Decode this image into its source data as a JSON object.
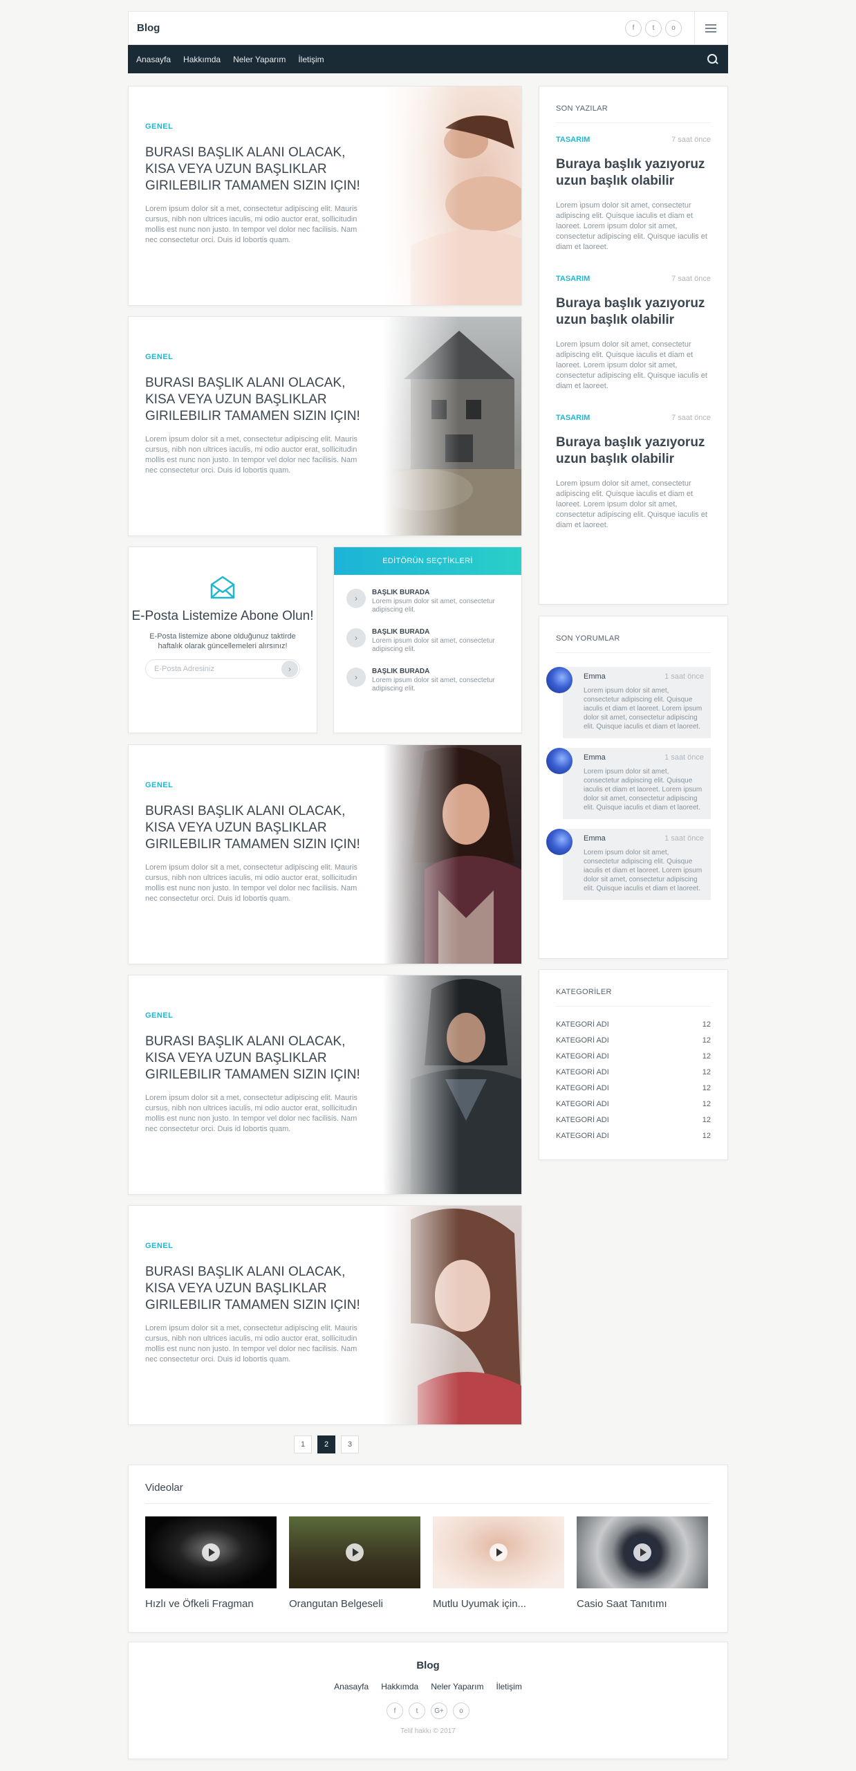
{
  "header": {
    "brand": "Blog",
    "social": [
      "f",
      "t",
      "o"
    ],
    "menu_icon": "hamburger-icon"
  },
  "nav": {
    "links": [
      "Anasayfa",
      "Hakkımda",
      "Neler Yaparım",
      "İletişim"
    ],
    "search_icon": "search-icon"
  },
  "posts": [
    {
      "category": "GENEL",
      "title": "BURASI BAŞLIK ALANI OLACAK, KISA VEYA UZUN BAŞLIKLAR GIRILEBILIR TAMAMEN SIZIN IÇIN!",
      "excerpt": "Lorem ipsum dolor sit a met, consectetur adipiscing elit. Mauris cursus, nibh non ultrices iaculis, mi odio auctor erat, sollicitudin mollis est nunc non justo. In tempor vel dolor nec facilisis. Nam nec consectetur orci. Duis id lobortis quam."
    },
    {
      "category": "GENEL",
      "title": "BURASI BAŞLIK ALANI OLACAK, KISA VEYA UZUN BAŞLIKLAR GIRILEBILIR TAMAMEN SIZIN IÇIN!",
      "excerpt": "Lorem ipsum dolor sit a met, consectetur adipiscing elit. Mauris cursus, nibh non ultrices iaculis, mi odio auctor erat, sollicitudin mollis est nunc non justo. In tempor vel dolor nec facilisis. Nam nec consectetur orci. Duis id lobortis quam."
    },
    {
      "category": "GENEL",
      "title": "BURASI BAŞLIK ALANI OLACAK, KISA VEYA UZUN BAŞLIKLAR GIRILEBILIR TAMAMEN SIZIN IÇIN!",
      "excerpt": "Lorem ipsum dolor sit a met, consectetur adipiscing elit. Mauris cursus, nibh non ultrices iaculis, mi odio auctor erat, sollicitudin mollis est nunc non justo. In tempor vel dolor nec facilisis. Nam nec consectetur orci. Duis id lobortis quam."
    },
    {
      "category": "GENEL",
      "title": "BURASI BAŞLIK ALANI OLACAK, KISA VEYA UZUN BAŞLIKLAR GIRILEBILIR TAMAMEN SIZIN IÇIN!",
      "excerpt": "Lorem ipsum dolor sit a met, consectetur adipiscing elit. Mauris cursus, nibh non ultrices iaculis, mi odio auctor erat, sollicitudin mollis est nunc non justo. In tempor vel dolor nec facilisis. Nam nec consectetur orci. Duis id lobortis quam."
    },
    {
      "category": "GENEL",
      "title": "BURASI BAŞLIK ALANI OLACAK, KISA VEYA UZUN BAŞLIKLAR GIRILEBILIR TAMAMEN SIZIN IÇIN!",
      "excerpt": "Lorem ipsum dolor sit a met, consectetur adipiscing elit. Mauris cursus, nibh non ultrices iaculis, mi odio auctor erat, sollicitudin mollis est nunc non justo. In tempor vel dolor nec facilisis. Nam nec consectetur orci. Duis id lobortis quam."
    }
  ],
  "subscribe": {
    "title": "E-Posta Listemize Abone Olun!",
    "text": "E-Posta listemize abone olduğunuz taktirde haftalık olarak güncellemeleri alırsınız!",
    "placeholder": "E-Posta Adresiniz",
    "icon": "envelope-icon"
  },
  "editor_picks": {
    "title": "EDİTÖRÜN SEÇTİKLERİ",
    "items": [
      {
        "title": "BAŞLIK BURADA",
        "text": "Lorem ipsum dolor sit amet, consectetur adipiscing elit."
      },
      {
        "title": "BAŞLIK BURADA",
        "text": "Lorem ipsum dolor sit amet, consectetur adipiscing elit."
      },
      {
        "title": "BAŞLIK BURADA",
        "text": "Lorem ipsum dolor sit amet, consectetur adipiscing elit."
      }
    ]
  },
  "pagination": [
    "1",
    "2",
    "3"
  ],
  "pagination_active": "2",
  "recent": {
    "title": "SON YAZILAR",
    "items": [
      {
        "category": "TASARIM",
        "time": "7 saat önce",
        "title": "Buraya başlık yazıyoruz uzun başlık olabilir",
        "excerpt": "Lorem ipsum dolor sit amet, consectetur adipiscing elit. Quisque iaculis et diam et laoreet. Lorem ipsum dolor sit amet, consectetur adipiscing elit. Quisque iaculis et diam et laoreet."
      },
      {
        "category": "TASARIM",
        "time": "7 saat önce",
        "title": "Buraya başlık yazıyoruz uzun başlık olabilir",
        "excerpt": "Lorem ipsum dolor sit amet, consectetur adipiscing elit. Quisque iaculis et diam et laoreet. Lorem ipsum dolor sit amet, consectetur adipiscing elit. Quisque iaculis et diam et laoreet."
      },
      {
        "category": "TASARIM",
        "time": "7 saat önce",
        "title": "Buraya başlık yazıyoruz uzun başlık olabilir",
        "excerpt": "Lorem ipsum dolor sit amet, consectetur adipiscing elit. Quisque iaculis et diam et laoreet. Lorem ipsum dolor sit amet, consectetur adipiscing elit. Quisque iaculis et diam et laoreet."
      }
    ]
  },
  "comments": {
    "title": "SON YORUMLAR",
    "items": [
      {
        "name": "Emma",
        "time": "1 saat önce",
        "text": "Lorem ipsum dolor sit amet, consectetur adipiscing elit. Quisque iaculis et diam et laoreet. Lorem ipsum dolor sit amet, consectetur adipiscing elit. Quisque iaculis et diam et laoreet."
      },
      {
        "name": "Emma",
        "time": "1 saat önce",
        "text": "Lorem ipsum dolor sit amet, consectetur adipiscing elit. Quisque iaculis et diam et laoreet. Lorem ipsum dolor sit amet, consectetur adipiscing elit. Quisque iaculis et diam et laoreet."
      },
      {
        "name": "Emma",
        "time": "1 saat önce",
        "text": "Lorem ipsum dolor sit amet, consectetur adipiscing elit. Quisque iaculis et diam et laoreet. Lorem ipsum dolor sit amet, consectetur adipiscing elit. Quisque iaculis et diam et laoreet."
      }
    ]
  },
  "categories": {
    "title": "KATEGORİLER",
    "items": [
      {
        "name": "KATEGORİ ADI",
        "count": "12"
      },
      {
        "name": "KATEGORİ ADI",
        "count": "12"
      },
      {
        "name": "KATEGORİ ADI",
        "count": "12"
      },
      {
        "name": "KATEGORİ ADI",
        "count": "12"
      },
      {
        "name": "KATEGORİ ADI",
        "count": "12"
      },
      {
        "name": "KATEGORİ ADI",
        "count": "12"
      },
      {
        "name": "KATEGORİ ADI",
        "count": "12"
      },
      {
        "name": "KATEGORİ ADI",
        "count": "12"
      }
    ]
  },
  "videos": {
    "title": "Videolar",
    "items": [
      {
        "name": "Hızlı ve Öfkeli Fragman"
      },
      {
        "name": "Orangutan Belgeseli"
      },
      {
        "name": "Mutlu Uyumak için..."
      },
      {
        "name": "Casio Saat Tanıtımı"
      }
    ]
  },
  "footer": {
    "brand": "Blog",
    "links": [
      "Anasayfa",
      "Hakkımda",
      "Neler Yaparım",
      "İletişim"
    ],
    "social": [
      "f",
      "t",
      "G+",
      "o"
    ],
    "copyright": "Telif hakkı © 2017"
  },
  "colors": {
    "accent": "#1fb6cf",
    "nav_bg": "#1a2b36",
    "page_bg": "#f6f6f4"
  }
}
